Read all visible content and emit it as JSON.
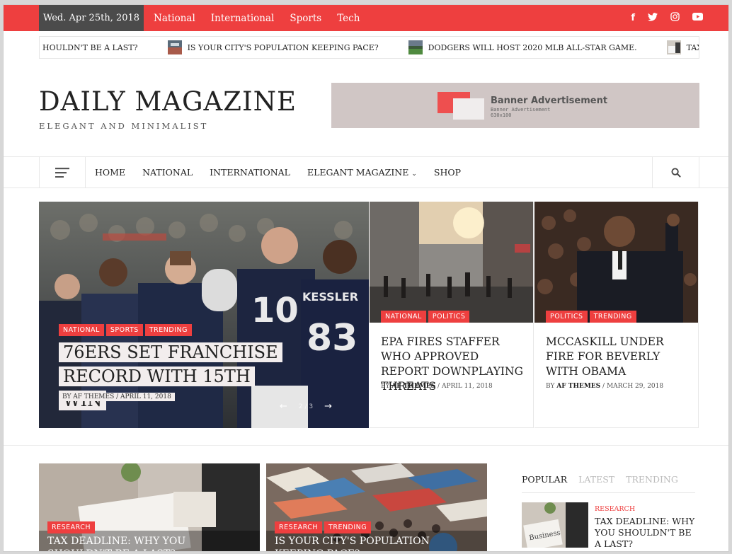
{
  "topbar": {
    "date": "Wed. Apr 25th, 2018",
    "links": [
      "National",
      "International",
      "Sports",
      "Tech"
    ],
    "social": [
      {
        "icon": "facebook-icon",
        "glyph": "f"
      },
      {
        "icon": "twitter-icon",
        "glyph": "t"
      },
      {
        "icon": "instagram-icon",
        "glyph": "◎"
      },
      {
        "icon": "youtube-icon",
        "glyph": "▶"
      }
    ]
  },
  "ticker": {
    "items": [
      "HOULDN'T BE A LAST?",
      "IS YOUR CITY'S POPULATION KEEPING PACE?",
      "DODGERS WILL HOST 2020 MLB ALL-STAR GAME.",
      "TAX DEADLINE: WI"
    ]
  },
  "header": {
    "logo": "DAILY MAGAZINE",
    "tagline": "ELEGANT AND MINIMALIST",
    "banner": {
      "title": "Banner Advertisement",
      "subtitle": "Banner Advertisement",
      "size": "630x100"
    }
  },
  "nav": {
    "items": [
      "HOME",
      "NATIONAL",
      "INTERNATIONAL",
      "ELEGANT MAGAZINE",
      "SHOP"
    ]
  },
  "featured": {
    "main": {
      "tags": [
        "NATIONAL",
        "SPORTS",
        "TRENDING"
      ],
      "title": "76ERS SET FRANCHISE RECORD WITH 15TH WIN",
      "meta": "BY AF THEMES  /  APRIL 11, 2018",
      "pager": "2 / 3"
    },
    "cards": [
      {
        "tags": [
          "NATIONAL",
          "POLITICS"
        ],
        "title": "EPA FIRES STAFFER WHO APPROVED REPORT DOWNPLAYING THREATS",
        "by": "BY",
        "author": "AF THEMES",
        "date": "/ APRIL 11, 2018"
      },
      {
        "tags": [
          "POLITICS",
          "TRENDING"
        ],
        "title": "MCCASKILL UNDER FIRE FOR BEVERLY WITH OBAMA",
        "by": "BY",
        "author": "AF THEMES",
        "date": "/ MARCH 29, 2018"
      }
    ]
  },
  "bottom": [
    {
      "tags": [
        "RESEARCH"
      ],
      "title": "TAX DEADLINE: WHY YOU SHOULDN'T BE A LAST?"
    },
    {
      "tags": [
        "RESEARCH",
        "TRENDING"
      ],
      "title": "IS YOUR CITY'S POPULATION KEEPING PACE?"
    }
  ],
  "sidebar": {
    "tabs": [
      "POPULAR",
      "LATEST",
      "TRENDING"
    ],
    "popular": {
      "category": "RESEARCH",
      "title": "TAX DEADLINE: WHY YOU SHOULDN'T BE A LAST?"
    }
  },
  "colors": {
    "accent": "#ee3f3f",
    "dark": "#4b4b4b"
  }
}
